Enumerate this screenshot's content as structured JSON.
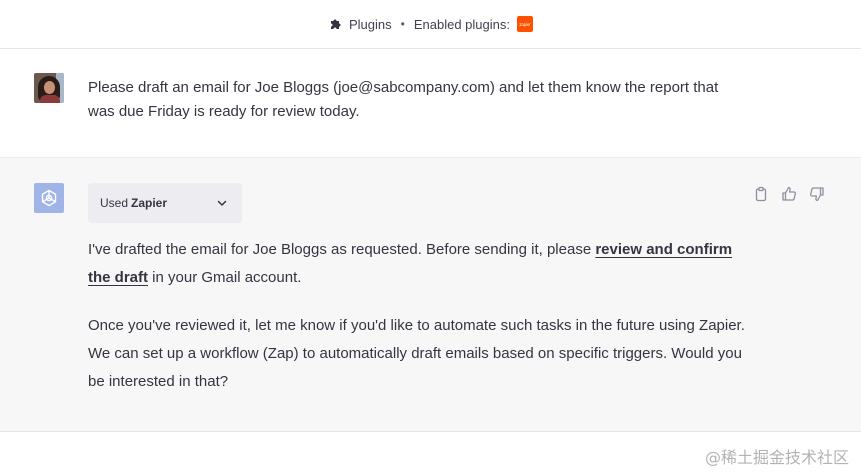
{
  "header": {
    "plugins_label": "Plugins",
    "separator": "•",
    "enabled_label": "Enabled plugins:",
    "enabled_plugin_badge": "zapier"
  },
  "user_message": {
    "text": "Please draft an email for Joe Bloggs (joe@sabcompany.com) and let them know the report that was due Friday is ready for review today."
  },
  "assistant_message": {
    "plugin_used": {
      "prefix": "Used",
      "name": "Zapier"
    },
    "paragraph1": {
      "before": "I've drafted the email for Joe Bloggs as requested. Before sending it, please ",
      "link": "review and confirm the draft",
      "after": " in your Gmail account."
    },
    "paragraph2": "Once you've reviewed it, let me know if you'd like to automate such tasks in the future using Zapier. We can set up a workflow (Zap) to automatically draft emails based on specific triggers. Would you be interested in that?"
  },
  "icons": {
    "header": "puzzle-icon",
    "actions": [
      "clipboard-icon",
      "thumbs-up-icon",
      "thumbs-down-icon"
    ],
    "pill": "chevron-down-icon"
  },
  "colors": {
    "assistant_bg": "#f7f7f8",
    "gpt_avatar": "#a0b4e8",
    "zapier_orange": "#ff4f00",
    "text": "#343541"
  },
  "watermark": "@稀土掘金技术社区"
}
